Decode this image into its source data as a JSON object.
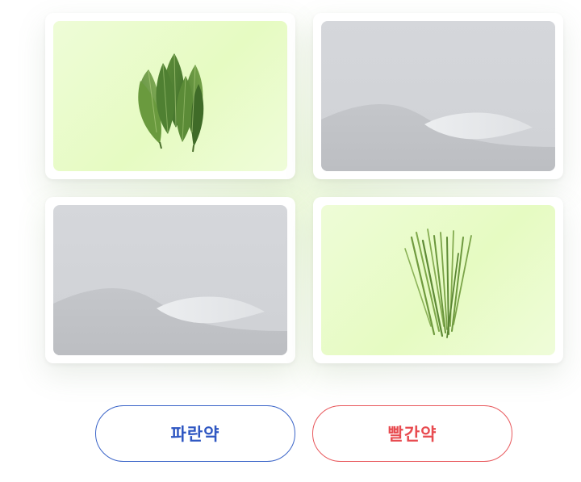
{
  "cards": [
    {
      "image": "bay-leaves",
      "style": "plant"
    },
    {
      "image": "image-placeholder",
      "style": "placeholder"
    },
    {
      "image": "image-placeholder",
      "style": "placeholder"
    },
    {
      "image": "chive-stems",
      "style": "plant"
    }
  ],
  "buttons": {
    "blue_label": "파란약",
    "red_label": "빨간약"
  },
  "colors": {
    "blue": "#2f57c2",
    "red": "#e84b50",
    "plant_bg": "#e6fbc2",
    "placeholder_bg": "#d1d3d7"
  }
}
